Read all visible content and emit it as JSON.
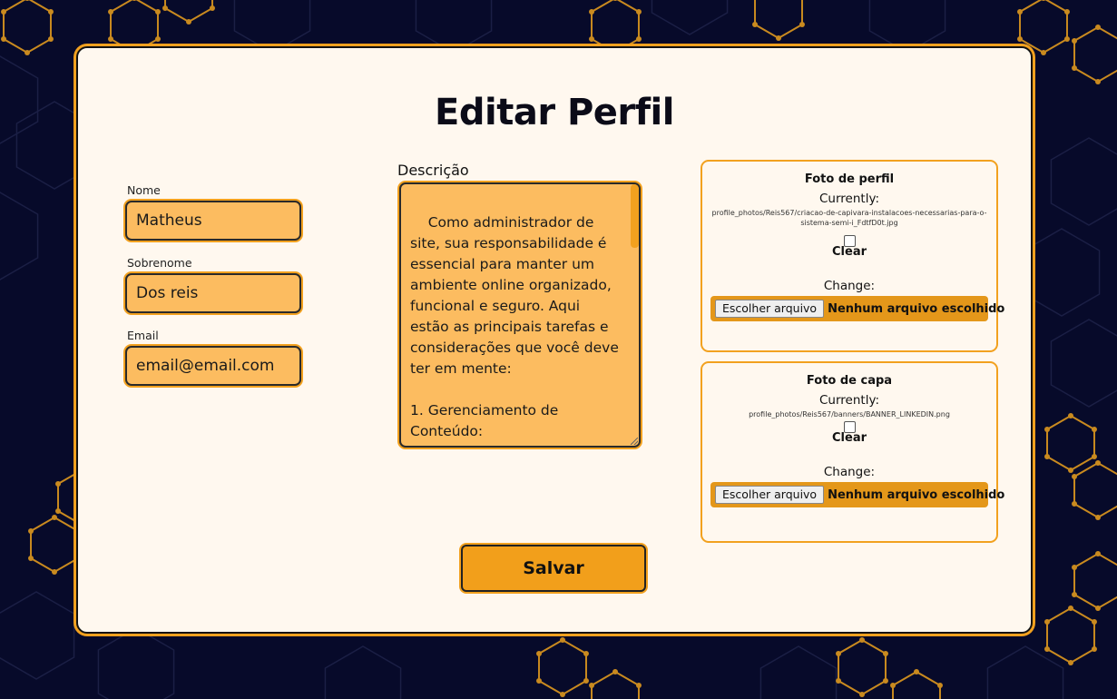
{
  "page": {
    "title": "Editar Perfil"
  },
  "form": {
    "nome_label": "Nome",
    "nome_value": "Matheus",
    "sobrenome_label": "Sobrenome",
    "sobrenome_value": "Dos reis",
    "email_label": "Email",
    "email_value": "email@email.com",
    "descricao_label": "Descrição",
    "descricao_value": "Como administrador de site, sua responsabilidade é essencial para manter um ambiente online organizado, funcional e seguro. Aqui estão as principais tarefas e considerações que você deve ter em mente:\n\n1. Gerenciamento de Conteúdo:"
  },
  "foto_perfil": {
    "title": "Foto de perfil",
    "currently_label": "Currently:",
    "path": "profile_photos/Reis567/criacao-de-capivara-instalacoes-necessarias-para-o-sistema-semi-i_FdtfD0t.jpg",
    "clear_label": "Clear",
    "change_label": "Change:",
    "file_button": "Escolher arquivo",
    "file_status": "Nenhum arquivo escolhido"
  },
  "foto_capa": {
    "title": "Foto de capa",
    "currently_label": "Currently:",
    "path": "profile_photos/Reis567/banners/BANNER_LINKEDIN.png",
    "clear_label": "Clear",
    "change_label": "Change:",
    "file_button": "Escolher arquivo",
    "file_status": "Nenhum arquivo escolhido"
  },
  "actions": {
    "save_label": "Salvar"
  },
  "colors": {
    "background": "#070a2a",
    "hexagon": "#c98a1f",
    "card": "#fff8ef",
    "accent": "#f2a11f",
    "input_fill": "#fcbc60"
  }
}
